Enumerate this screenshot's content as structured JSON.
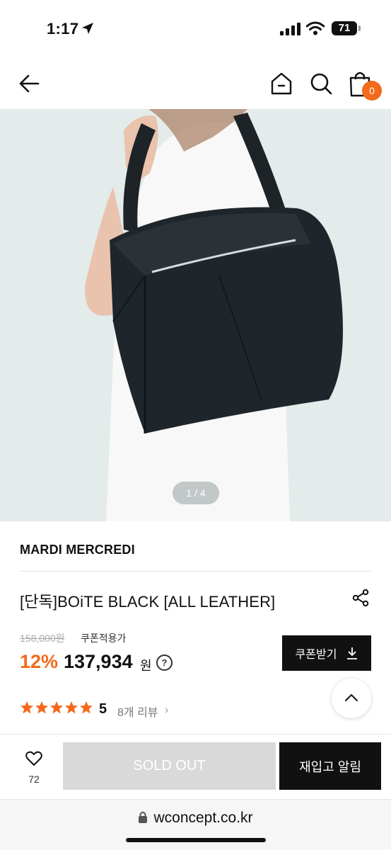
{
  "status_bar": {
    "time": "1:17",
    "battery": "71"
  },
  "header": {
    "cart_count": "0"
  },
  "gallery": {
    "pager": "1 / 4"
  },
  "product": {
    "brand": "MARDI MERCREDI",
    "name": "[단독]BOiTE BLACK [ALL LEATHER]",
    "original_price": "158,000원",
    "coupon_label": "쿠폰적용가",
    "discount": "12%",
    "price": "137,934",
    "currency": "원",
    "help": "?",
    "coupon_button": "쿠폰받기",
    "rating": "5",
    "review_count": "8개 리뷰",
    "review_chevron": "›"
  },
  "actions": {
    "likes": "72",
    "sold_out": "SOLD OUT",
    "restock": "재입고 알림"
  },
  "browser": {
    "url": "wconcept.co.kr"
  },
  "colors": {
    "accent": "#f26a1b",
    "dark": "#111111",
    "disabled": "#d9d9d9"
  },
  "icons": [
    "back-arrow-icon",
    "home-icon",
    "search-icon",
    "bag-icon",
    "share-icon",
    "download-icon",
    "star-icon",
    "chevron-up-icon",
    "heart-icon",
    "lock-icon"
  ]
}
